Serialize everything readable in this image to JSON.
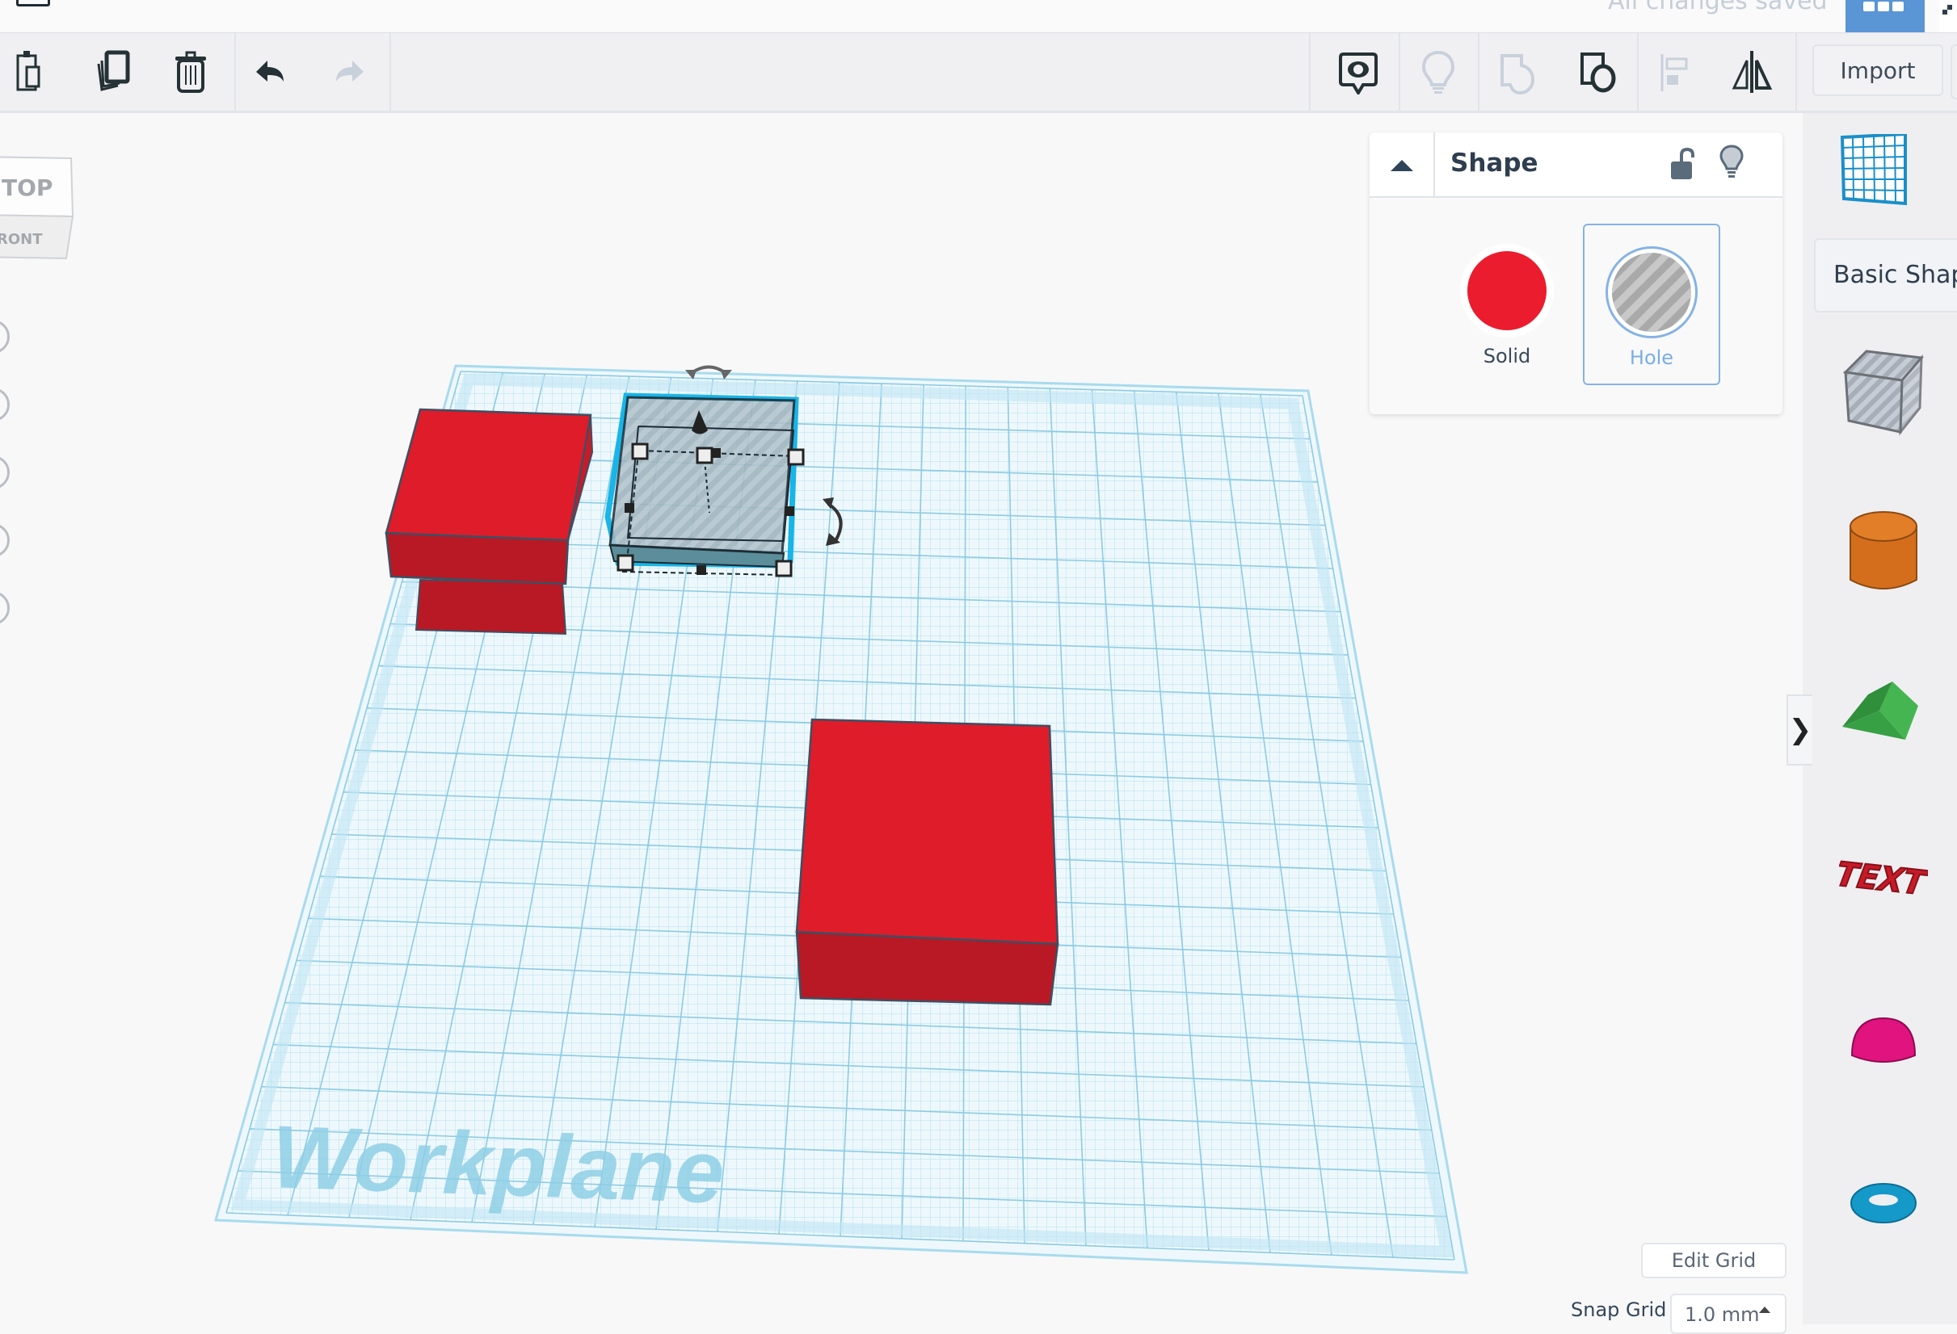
{
  "header": {
    "status_text": "All changes saved",
    "view_toggle_icon": "grid-view-icon",
    "fullscreen_icon": "fullscreen-icon"
  },
  "toolbar": {
    "left_tools": [
      {
        "name": "paste",
        "icon": "clipboard-icon",
        "enabled": true
      },
      {
        "name": "duplicate",
        "icon": "duplicate-icon",
        "enabled": true
      },
      {
        "name": "delete",
        "icon": "trash-icon",
        "enabled": true
      },
      {
        "name": "undo",
        "icon": "undo-icon",
        "enabled": true
      },
      {
        "name": "redo",
        "icon": "redo-icon",
        "enabled": false
      }
    ],
    "right_tools": [
      {
        "name": "notes",
        "icon": "note-eye-icon",
        "enabled": true
      },
      {
        "name": "show-all",
        "icon": "lightbulb-icon",
        "enabled": false
      },
      {
        "name": "group",
        "icon": "group-icon",
        "enabled": false
      },
      {
        "name": "ungroup",
        "icon": "ungroup-icon",
        "enabled": true
      },
      {
        "name": "align",
        "icon": "align-icon",
        "enabled": false
      },
      {
        "name": "mirror",
        "icon": "mirror-icon",
        "enabled": true
      }
    ],
    "import_label": "Import"
  },
  "viewcube": {
    "top_label": "TOP",
    "front_label": "RONT"
  },
  "workplane": {
    "label": "Workplane",
    "grid_color": "#9fd7ec",
    "objects": [
      {
        "type": "box",
        "mode": "solid",
        "color": "#df1c2a",
        "selected": false
      },
      {
        "type": "box",
        "mode": "hole",
        "color": "#9aa9b3",
        "selected": true
      },
      {
        "type": "box",
        "mode": "solid",
        "color": "#df1c2a",
        "selected": false
      }
    ]
  },
  "shape_panel": {
    "title": "Shape",
    "lock_icon": "unlock-icon",
    "visibility_icon": "lightbulb-icon",
    "modes": [
      {
        "label": "Solid",
        "color": "#ea1c2e",
        "selected": false
      },
      {
        "label": "Hole",
        "color": "#7aaee3",
        "selected": true
      }
    ]
  },
  "sidebar": {
    "workplane_tool_icon": "workplane-grid-icon",
    "category_label": "Basic Shapes",
    "shapes": [
      {
        "name": "box-hole",
        "icon": "striped-box-icon"
      },
      {
        "name": "cylinder",
        "icon": "cylinder-icon",
        "color": "#e07a22"
      },
      {
        "name": "roof",
        "icon": "roof-icon",
        "color": "#3fae4a"
      },
      {
        "name": "text",
        "icon": "text-3d-icon",
        "color": "#c61b28"
      },
      {
        "name": "half-sphere",
        "icon": "half-sphere-icon",
        "color": "#e0137f"
      },
      {
        "name": "torus",
        "icon": "torus-icon",
        "color": "#1599c9"
      }
    ],
    "toggle_glyph": "❯"
  },
  "grid_controls": {
    "edit_grid_label": "Edit Grid",
    "snap_grid_label": "Snap Grid",
    "snap_grid_value": "1.0 mm"
  }
}
